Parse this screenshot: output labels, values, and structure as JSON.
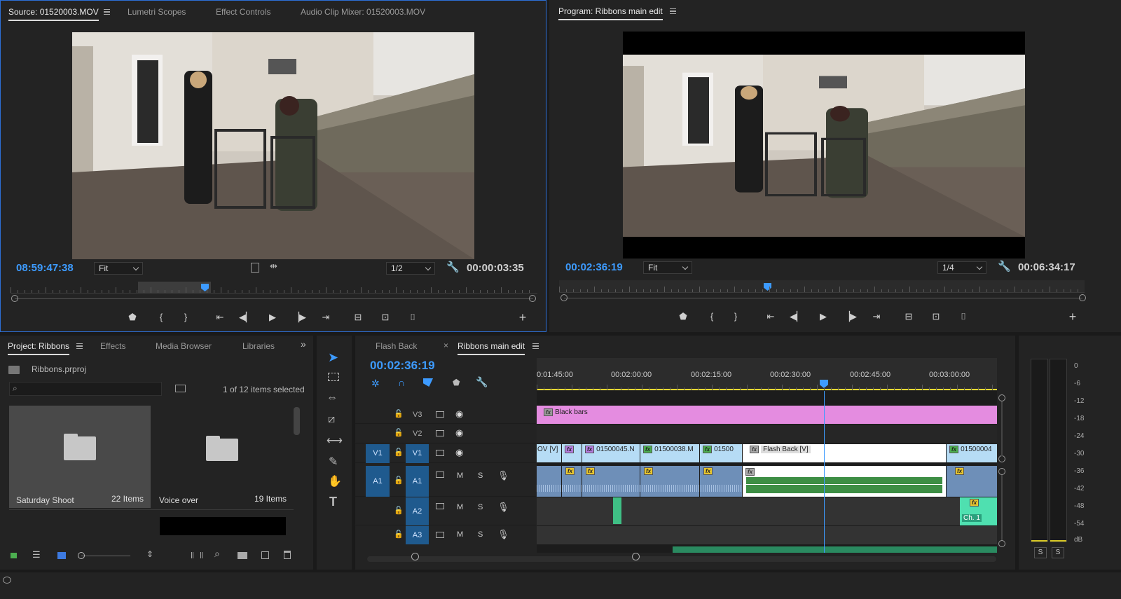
{
  "source": {
    "tabs": [
      "Source: 01520003.MOV",
      "Lumetri Scopes",
      "Effect Controls",
      "Audio Clip Mixer: 01520003.MOV"
    ],
    "timecode": "08:59:47:38",
    "fit": "Fit",
    "resolution": "1/2",
    "duration": "00:00:03:35"
  },
  "program": {
    "title": "Program: Ribbons main edit",
    "timecode": "00:02:36:19",
    "fit": "Fit",
    "resolution": "1/4",
    "duration": "00:06:34:17"
  },
  "project": {
    "tabs": [
      "Project: Ribbons",
      "Effects",
      "Media Browser",
      "Libraries"
    ],
    "file": "Ribbons.prproj",
    "search_placeholder": "",
    "selection": "1 of 12 items selected",
    "bins": [
      {
        "name": "Saturday Shoot",
        "count": "22 Items"
      },
      {
        "name": "Voice over",
        "count": "19 Items"
      }
    ]
  },
  "timeline": {
    "tabs": [
      "Flash Back",
      "Ribbons main edit"
    ],
    "timecode": "00:02:36:19",
    "ruler": [
      "0:01:45:00",
      "00:02:00:00",
      "00:02:15:00",
      "00:02:30:00",
      "00:02:45:00",
      "00:03:00:00"
    ],
    "tracks": {
      "v3": "V3",
      "v2": "V2",
      "v1_src": "V1",
      "v1": "V1",
      "a1_src": "A1",
      "a1": "A1",
      "a2": "A2",
      "a3": "A3",
      "m": "M",
      "s": "S"
    },
    "clips": {
      "black_bars": "Black bars",
      "ov": "OV [V]",
      "c1": "01500045.N",
      "c2": "01500038.M",
      "c3": "01500",
      "flashback": "Flash Back [V]",
      "c4": "01500004",
      "ch1": "Ch. 1",
      "fx": "fx"
    }
  },
  "meter": {
    "scale": [
      "0",
      "-6",
      "-12",
      "-18",
      "-24",
      "-30",
      "-36",
      "-42",
      "-48",
      "-54",
      "dB"
    ],
    "solo": [
      "S",
      "S"
    ]
  }
}
